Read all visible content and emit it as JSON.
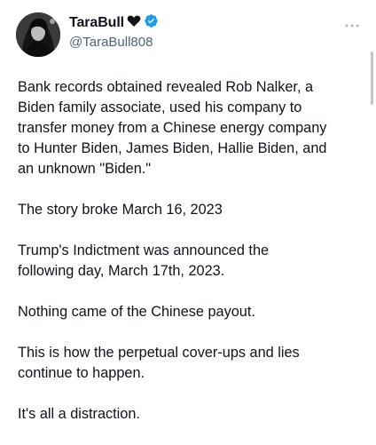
{
  "tweet": {
    "display_name": "TaraBull",
    "handle": "@TaraBull808",
    "icons": [
      "heart-icon",
      "verified-icon",
      "more-icon"
    ],
    "paragraphs": [
      {
        "lines": [
          "Bank records obtained revealed Rob Nalker, a",
          "Biden family associate, used his company to",
          "transfer money from a Chinese energy company",
          "to Hunter Biden, James Biden, Hallie Biden, and",
          "an unknown \"Biden.\""
        ]
      },
      {
        "lines": [
          "The story broke March 16, 2023"
        ]
      },
      {
        "lines": [
          "Trump's Indictment was announced the",
          "following day, March 17th, 2023."
        ]
      },
      {
        "lines": [
          "Nothing came of the Chinese payout."
        ]
      },
      {
        "lines": [
          "This is how the perpetual cover-ups and lies",
          "continue to happen."
        ]
      },
      {
        "lines": [
          "It's all a distraction."
        ]
      }
    ]
  },
  "colors": {
    "text": "#0f1419",
    "secondary": "#536471",
    "verified": "#1d9bf0"
  }
}
